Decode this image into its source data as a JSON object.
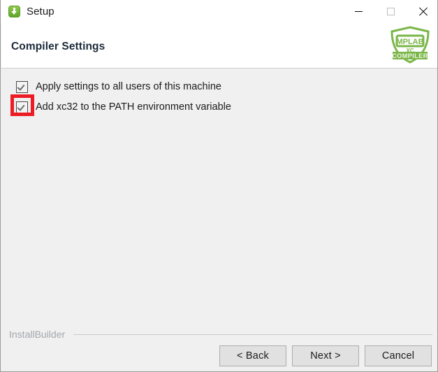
{
  "window": {
    "title": "Setup",
    "app_icon": "installer-download-icon",
    "controls": {
      "minimize": "minimize-icon",
      "maximize": "maximize-icon",
      "close": "close-icon"
    }
  },
  "header": {
    "page_title": "Compiler Settings",
    "brand": {
      "name": "mplab-xc-compiler-logo",
      "line1": "MPLAB",
      "line2": "XC",
      "line3": "COMPILER",
      "color": "#7ab648"
    }
  },
  "main": {
    "options": [
      {
        "id": "apply-settings-all-users",
        "label": "Apply settings to all users of this machine",
        "checked": true,
        "highlighted": false
      },
      {
        "id": "add-xc32-to-path",
        "label": "Add xc32 to the PATH environment variable",
        "checked": true,
        "highlighted": true
      }
    ],
    "highlight_color": "#ed1c24"
  },
  "footer": {
    "builder_label": "InstallBuilder",
    "buttons": [
      {
        "id": "back",
        "label": "< Back"
      },
      {
        "id": "next",
        "label": "Next >"
      },
      {
        "id": "cancel",
        "label": "Cancel"
      }
    ]
  }
}
